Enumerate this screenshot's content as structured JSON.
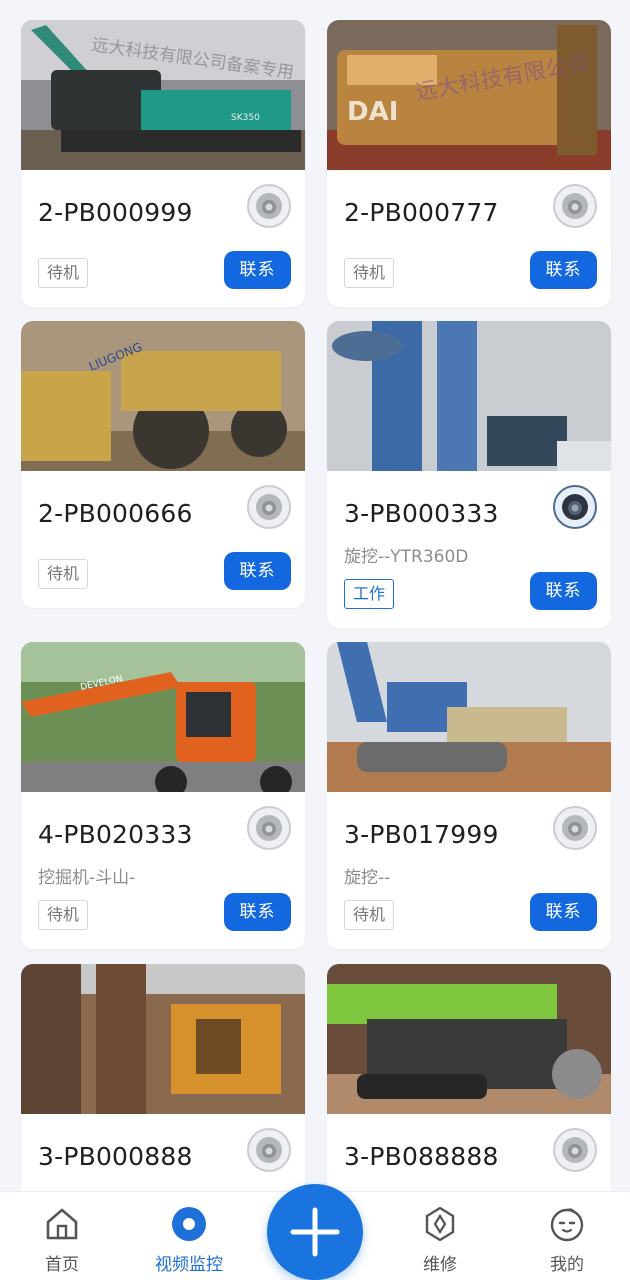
{
  "cards": [
    {
      "code": "2-PB000999",
      "subtitle": "",
      "status": "待机",
      "contact": "联系",
      "working": false,
      "camera_active": false,
      "photo_note": "excavator green, watermark",
      "watermark": "远大科技有限公司备案专用"
    },
    {
      "code": "2-PB000777",
      "subtitle": "",
      "status": "待机",
      "contact": "联系",
      "working": false,
      "camera_active": false,
      "photo_note": "excavator yellow",
      "watermark": "远大科技有限公司"
    },
    {
      "code": "2-PB000666",
      "subtitle": "",
      "status": "待机",
      "contact": "联系",
      "working": false,
      "camera_active": false,
      "photo_note": "wheel loader LiuGong",
      "watermark": ""
    },
    {
      "code": "3-PB000333",
      "subtitle": "旋挖--YTR360D",
      "status": "工作",
      "contact": "联系",
      "working": true,
      "camera_active": true,
      "photo_note": "rotary drilling rig blue",
      "watermark": ""
    },
    {
      "code": "4-PB020333",
      "subtitle": "挖掘机-斗山-",
      "status": "待机",
      "contact": "联系",
      "working": false,
      "camera_active": false,
      "photo_note": "Develon orange excavator",
      "watermark": ""
    },
    {
      "code": "3-PB017999",
      "subtitle": "旋挖--",
      "status": "待机",
      "contact": "联系",
      "working": false,
      "camera_active": false,
      "photo_note": "rotary rig blue on site",
      "watermark": ""
    },
    {
      "code": "3-PB000888",
      "subtitle": "",
      "status": "",
      "contact": "",
      "working": false,
      "camera_active": false,
      "photo_note": "orange rig",
      "watermark": ""
    },
    {
      "code": "3-PB088888",
      "subtitle": "",
      "status": "",
      "contact": "",
      "working": false,
      "camera_active": false,
      "photo_note": "green rig",
      "watermark": ""
    }
  ],
  "nav": {
    "home": "首页",
    "video": "视频监控",
    "repair": "维修",
    "mine": "我的"
  },
  "colors": {
    "accent": "#1468df",
    "background": "#f3f5fa"
  }
}
